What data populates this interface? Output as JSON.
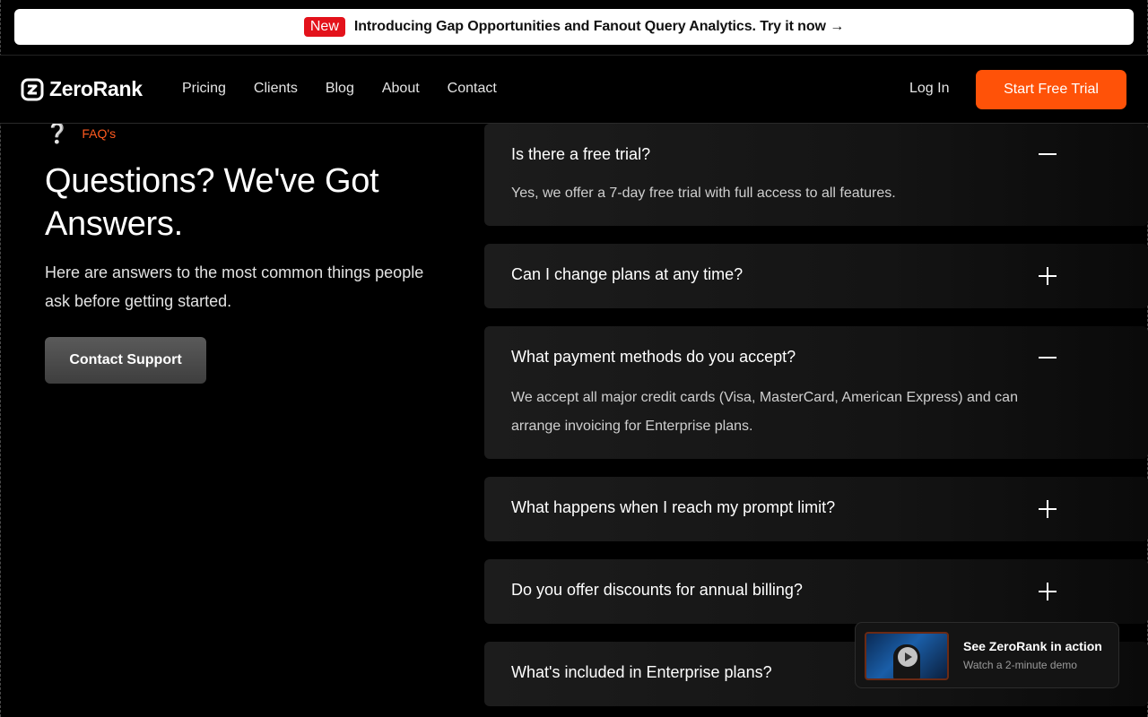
{
  "announcement": {
    "badge": "New",
    "text": "Introducing Gap Opportunities and Fanout Query Analytics. Try it now →"
  },
  "nav": {
    "brand": "ZeroRank",
    "links": [
      "Pricing",
      "Clients",
      "Blog",
      "About",
      "Contact"
    ],
    "login": "Log In",
    "cta": "Start Free Trial"
  },
  "intro": {
    "tag": "FAQ's",
    "heading": "Questions? We've Got Answers.",
    "subtext": "Here are answers to the most common things people ask before getting started.",
    "button": "Contact Support"
  },
  "faqs": [
    {
      "question": "Is there a free trial?",
      "answer": "Yes, we offer a 7-day free trial with full access to all features.",
      "expanded": true
    },
    {
      "question": "Can I change plans at any time?",
      "answer": "",
      "expanded": false
    },
    {
      "question": "What payment methods do you accept?",
      "answer": "We accept all major credit cards (Visa, MasterCard, American Express) and can arrange invoicing for Enterprise plans.",
      "expanded": true
    },
    {
      "question": "What happens when I reach my prompt limit?",
      "answer": "",
      "expanded": false
    },
    {
      "question": "Do you offer discounts for annual billing?",
      "answer": "",
      "expanded": false
    },
    {
      "question": "What's included in Enterprise plans?",
      "answer": "",
      "expanded": false
    }
  ],
  "video": {
    "title": "See ZeroRank in action",
    "subtitle": "Watch a 2-minute demo"
  },
  "colors": {
    "accent": "#ff5208",
    "badge": "#e3121b"
  },
  "icons": {
    "logo": "zerorank-logo-icon",
    "faq_tag": "question-mark-icon",
    "expanded": "minus-icon",
    "collapsed": "plus-icon",
    "video": "play-icon"
  }
}
